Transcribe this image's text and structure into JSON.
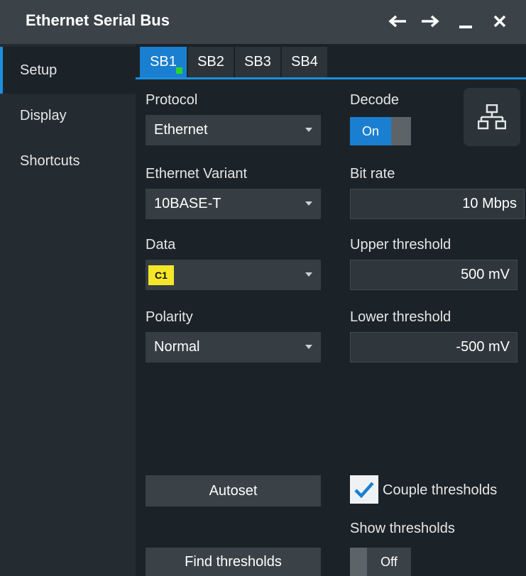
{
  "window": {
    "title": "Ethernet Serial Bus",
    "back_icon": "arrow-left-icon",
    "forward_icon": "arrow-right-icon",
    "minimize_icon": "minimize-icon",
    "close_icon": "close-icon"
  },
  "sidebar": {
    "items": [
      {
        "label": "Setup"
      },
      {
        "label": "Display"
      },
      {
        "label": "Shortcuts"
      }
    ]
  },
  "tabs": [
    {
      "label": "SB1"
    },
    {
      "label": "SB2"
    },
    {
      "label": "SB3"
    },
    {
      "label": "SB4"
    }
  ],
  "protocol": {
    "label": "Protocol",
    "value": "Ethernet"
  },
  "decode": {
    "label": "Decode",
    "state": "On"
  },
  "variant": {
    "label": "Ethernet Variant",
    "value": "10BASE-T"
  },
  "bitrate": {
    "label": "Bit rate",
    "value": "10 Mbps"
  },
  "data": {
    "label": "Data",
    "source": "C1"
  },
  "upper": {
    "label": "Upper threshold",
    "value": "500 mV"
  },
  "polarity": {
    "label": "Polarity",
    "value": "Normal"
  },
  "lower": {
    "label": "Lower threshold",
    "value": "-500 mV"
  },
  "autoset": {
    "label": "Autoset"
  },
  "couple": {
    "label": "Couple thresholds",
    "checked": true
  },
  "show_thresholds": {
    "label": "Show thresholds",
    "state": "Off"
  },
  "find": {
    "label": "Find thresholds"
  },
  "colors": {
    "accent": "#1a7fd0",
    "chip": "#f5e62a",
    "active_dot": "#2ad62a"
  }
}
